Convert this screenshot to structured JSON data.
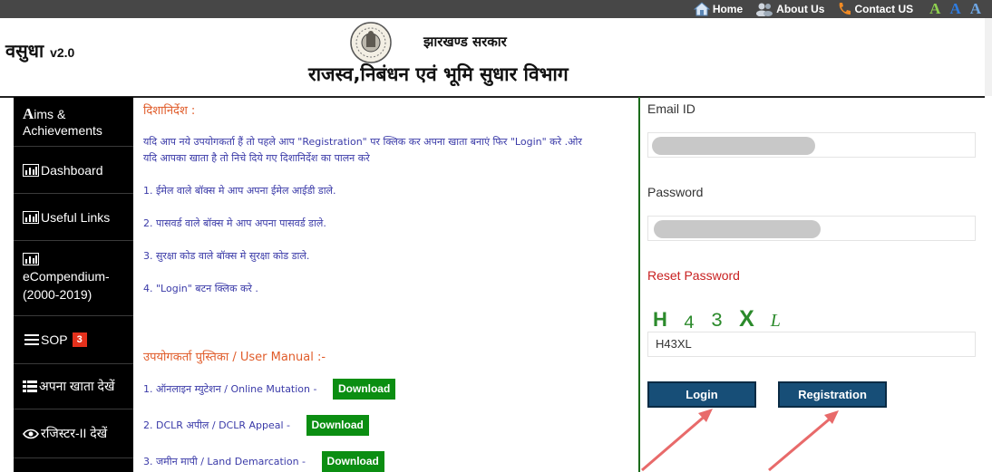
{
  "topnav": {
    "home": "Home",
    "about": "About Us",
    "contact": "Contact US",
    "font_increase": "A",
    "font_normal": "A",
    "font_decrease": "A"
  },
  "header": {
    "brand": "वसुधा",
    "version": "v2.0",
    "government": "झारखण्ड सरकार",
    "department": "राजस्व,निबंधन एवं भूमि सुधार  विभाग"
  },
  "sidebar": {
    "items": [
      {
        "label": "ims & Achievements",
        "prefix": "A",
        "icon": "aims-icon"
      },
      {
        "label": "Dashboard",
        "icon": "chart-icon"
      },
      {
        "label": "Useful Links",
        "icon": "chart-icon"
      },
      {
        "label": "eCompendium-(2000-2019)",
        "icon": "chart-icon"
      },
      {
        "label": "SOP",
        "badge": "3",
        "icon": "list-icon"
      },
      {
        "label": "अपना खाता देखें",
        "icon": "ledger-icon"
      },
      {
        "label": "रजिस्टर-II देखें",
        "icon": "eye-icon"
      }
    ]
  },
  "guidelines": {
    "title": "दिशानिर्देश :",
    "intro1": "यदि आप नये उपयोगकर्ता हैं तो पहले आप \"Registration\" पर क्लिक कर अपना खाता बनाएं फिर \"Login\" करे .ओर",
    "intro2": "यदि आपका खाता है तो निचे दिये गए दिशानिर्देश का पालन करे",
    "steps": [
      "1. ईमेल वाले बॉक्स मे आप अपना ईमेल आईडी डाले.",
      "2. पासवर्ड वाले बॉक्स मे आप अपना पासवर्ड डाले.",
      "3. सुरक्षा कोड वाले बॉक्स मे सुरक्षा कोड डाले.",
      "4. \"Login\" बटन क्लिक करे ."
    ]
  },
  "manual": {
    "title": "उपयोगकर्ता पुस्तिका / User Manual :-",
    "download_label": "Download",
    "items": [
      "1. ऑनलाइन म्युटेशन / Online Mutation -",
      "2. DCLR अपील / DCLR Appeal -",
      "3. जमीन मापी / Land Demarcation -"
    ]
  },
  "login": {
    "email_label": "Email ID",
    "password_label": "Password",
    "reset_label": "Reset Password",
    "captcha_chars": [
      "H",
      "4",
      "3",
      "X",
      "L"
    ],
    "captcha_value": "H43XL",
    "login_button": "Login",
    "register_button": "Registration"
  },
  "colors": {
    "topbar": "#474747",
    "sidebar": "#000000",
    "guideline_title": "#e05c2a",
    "guideline_text": "#3a3aa8",
    "download_button": "#0b8e12",
    "action_button": "#174e77",
    "reset_link": "#c82020",
    "captcha": "#2b8a2b",
    "arrow": "#e86a6a"
  }
}
